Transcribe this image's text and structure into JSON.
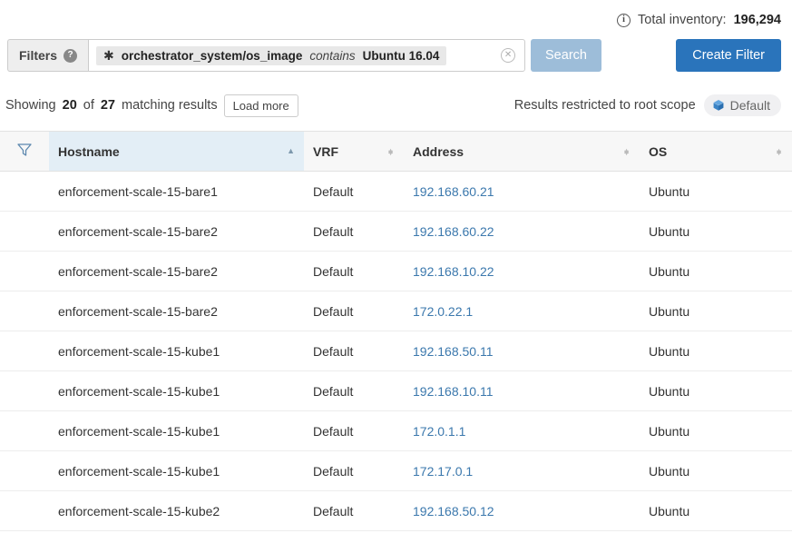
{
  "header": {
    "info_icon": "info-circle-icon",
    "inventory_label": "Total inventory:",
    "inventory_count": "196,294"
  },
  "filter_bar": {
    "label": "Filters",
    "help_icon": "help-circle-icon",
    "chip": {
      "star_icon": "✱",
      "field": "orchestrator_system/os_image",
      "operator": "contains",
      "value": "Ubuntu 16.04"
    },
    "clear_icon": "✕",
    "search_label": "Search",
    "create_filter_label": "Create Filter"
  },
  "results": {
    "showing_prefix": "Showing",
    "shown_count": "20",
    "of_text": "of",
    "total_count": "27",
    "suffix": "matching results",
    "load_more_label": "Load more",
    "scope_text": "Results restricted to root scope",
    "scope_badge_label": "Default",
    "scope_badge_icon": "cube-icon"
  },
  "table": {
    "filter_icon": "funnel-filter-icon",
    "columns": [
      {
        "label": "Hostname",
        "sort": "asc"
      },
      {
        "label": "VRF",
        "sort": "none"
      },
      {
        "label": "Address",
        "sort": "none"
      },
      {
        "label": "OS",
        "sort": "none"
      }
    ],
    "rows": [
      {
        "hostname": "enforcement-scale-15-bare1",
        "vrf": "Default",
        "address": "192.168.60.21",
        "os": "Ubuntu"
      },
      {
        "hostname": "enforcement-scale-15-bare2",
        "vrf": "Default",
        "address": "192.168.60.22",
        "os": "Ubuntu"
      },
      {
        "hostname": "enforcement-scale-15-bare2",
        "vrf": "Default",
        "address": "192.168.10.22",
        "os": "Ubuntu"
      },
      {
        "hostname": "enforcement-scale-15-bare2",
        "vrf": "Default",
        "address": "172.0.22.1",
        "os": "Ubuntu"
      },
      {
        "hostname": "enforcement-scale-15-kube1",
        "vrf": "Default",
        "address": "192.168.50.11",
        "os": "Ubuntu"
      },
      {
        "hostname": "enforcement-scale-15-kube1",
        "vrf": "Default",
        "address": "192.168.10.11",
        "os": "Ubuntu"
      },
      {
        "hostname": "enforcement-scale-15-kube1",
        "vrf": "Default",
        "address": "172.0.1.1",
        "os": "Ubuntu"
      },
      {
        "hostname": "enforcement-scale-15-kube1",
        "vrf": "Default",
        "address": "172.17.0.1",
        "os": "Ubuntu"
      },
      {
        "hostname": "enforcement-scale-15-kube2",
        "vrf": "Default",
        "address": "192.168.50.12",
        "os": "Ubuntu"
      }
    ]
  },
  "colors": {
    "primary_button": "#2a74bb",
    "muted_button": "#9dbdd9",
    "link": "#3b78ad",
    "sorted_header": "#e3eef6"
  }
}
